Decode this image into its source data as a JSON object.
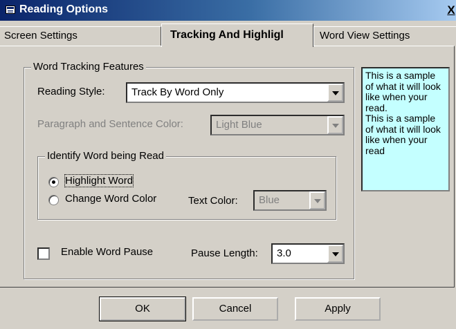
{
  "window": {
    "title": "Reading Options",
    "close_label": "X"
  },
  "tabs": [
    {
      "label": "Screen  Settings"
    },
    {
      "label": "Tracking And Highligl"
    },
    {
      "label": "Word View Settings"
    }
  ],
  "word_tracking": {
    "group_title": "Word Tracking Features",
    "reading_style_label": "Reading Style:",
    "reading_style_value": "Track By Word Only",
    "paragraph_color_label": "Paragraph and Sentence Color:",
    "paragraph_color_value": "Light Blue",
    "identify": {
      "group_title": "Identify Word being Read",
      "option_highlight": "Highlight Word",
      "option_change_color": "Change Word Color",
      "text_color_label": "Text Color:",
      "text_color_value": "Blue"
    },
    "enable_pause_label": "Enable Word Pause",
    "pause_length_label": "Pause Length:",
    "pause_length_value": "3.0"
  },
  "sample": {
    "text1": "This is a sample of what it will look like when your read.",
    "text2": "This is a sample of what it will look like when your read",
    "background": "#c4ffff"
  },
  "buttons": {
    "ok": "OK",
    "cancel": "Cancel",
    "apply": "Apply"
  },
  "colors": {
    "titlebar_start": "#0a246a",
    "titlebar_end": "#a6caf0",
    "dialog_bg": "#d4d0c8"
  }
}
